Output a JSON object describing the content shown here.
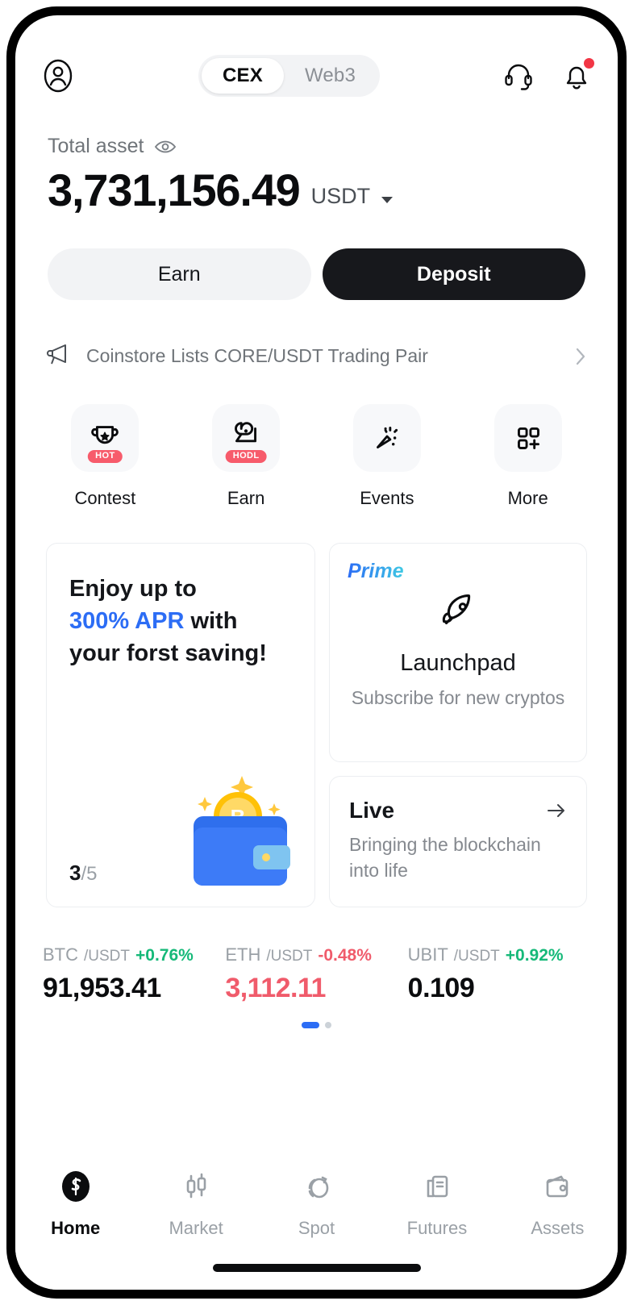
{
  "header": {
    "avatar_icon": "user-circle-icon",
    "tabs": [
      {
        "label": "CEX",
        "active": true
      },
      {
        "label": "Web3",
        "active": false
      }
    ],
    "support_icon": "headset-icon",
    "notification_icon": "bell-icon",
    "notification_badge": true
  },
  "balance": {
    "label": "Total asset",
    "eye_icon": "eye-icon",
    "amount": "3,731,156.49",
    "currency": "USDT",
    "currency_caret_icon": "caret-down-icon"
  },
  "actions": {
    "earn_label": "Earn",
    "deposit_label": "Deposit"
  },
  "announcement": {
    "icon": "megaphone-icon",
    "text": "Coinstore Lists CORE/USDT Trading Pair",
    "chevron_icon": "chevron-right-icon"
  },
  "quick_actions": [
    {
      "label": "Contest",
      "icon": "trophy-icon",
      "badge": "HOT"
    },
    {
      "label": "Earn",
      "icon": "piggy-hand-icon",
      "badge": "HODL"
    },
    {
      "label": "Events",
      "icon": "confetti-icon",
      "badge": ""
    },
    {
      "label": "More",
      "icon": "grid-plus-icon",
      "badge": ""
    }
  ],
  "promo": {
    "saving_card": {
      "line1": "Enjoy up to",
      "highlight": "300% APR",
      "line2_rest": " with",
      "line3": "your forst saving!",
      "page_current": "3",
      "page_total": "/5",
      "art_icon": "wallet-bitcoin-icon",
      "highlight_color": "#2c6df5"
    },
    "launchpad_card": {
      "tag": "Prime",
      "icon": "rocket-icon",
      "title": "Launchpad",
      "subtitle": "Subscribe for new cryptos"
    },
    "live_card": {
      "title": "Live",
      "arrow_icon": "arrow-right-icon",
      "subtitle": "Bringing the blockchain into life"
    }
  },
  "tickers": [
    {
      "base": "BTC",
      "quote": "/USDT",
      "change": "+0.76%",
      "change_dir": "up",
      "price": "91,953.41",
      "price_dir": "neutral"
    },
    {
      "base": "ETH",
      "quote": "/USDT",
      "change": "-0.48%",
      "change_dir": "down",
      "price": "3,112.11",
      "price_dir": "down"
    },
    {
      "base": "UBIT",
      "quote": "/USDT",
      "change": "+0.92%",
      "change_dir": "up",
      "price": "0.109",
      "price_dir": "neutral"
    }
  ],
  "carousel": {
    "total": 2,
    "active_index": 0
  },
  "bottom_nav": [
    {
      "label": "Home",
      "icon": "coinstore-logo-icon",
      "active": true
    },
    {
      "label": "Market",
      "icon": "candlestick-icon",
      "active": false
    },
    {
      "label": "Spot",
      "icon": "spot-swap-icon",
      "active": false
    },
    {
      "label": "Futures",
      "icon": "futures-doc-icon",
      "active": false
    },
    {
      "label": "Assets",
      "icon": "wallet-icon",
      "active": false
    }
  ],
  "colors": {
    "up": "#16b979",
    "down": "#f05b6b",
    "accent": "#2c6df5",
    "badge": "#f75b6b",
    "primary_btn": "#17181c"
  }
}
